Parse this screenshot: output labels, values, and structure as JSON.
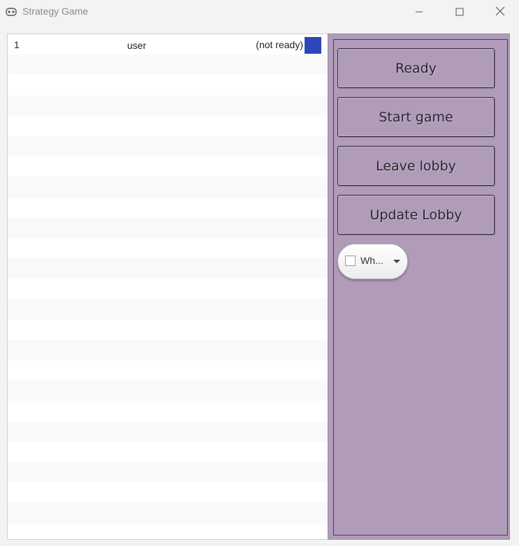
{
  "window": {
    "title": "Strategy Game",
    "icon": "gamepad-icon",
    "controls": [
      "minimize-icon",
      "maximize-icon",
      "close-icon"
    ]
  },
  "players": [
    {
      "number": "1",
      "name": "user",
      "status": "(not ready)",
      "color": "#2f46b8"
    }
  ],
  "actions": {
    "ready_label": "Ready",
    "start_label": "Start game",
    "leave_label": "Leave lobby",
    "update_label": "Update Lobby"
  },
  "color_select": {
    "selected": "Wh..."
  },
  "colors": {
    "panel": "#b09cb8",
    "player_swatch": "#2f46b8"
  }
}
